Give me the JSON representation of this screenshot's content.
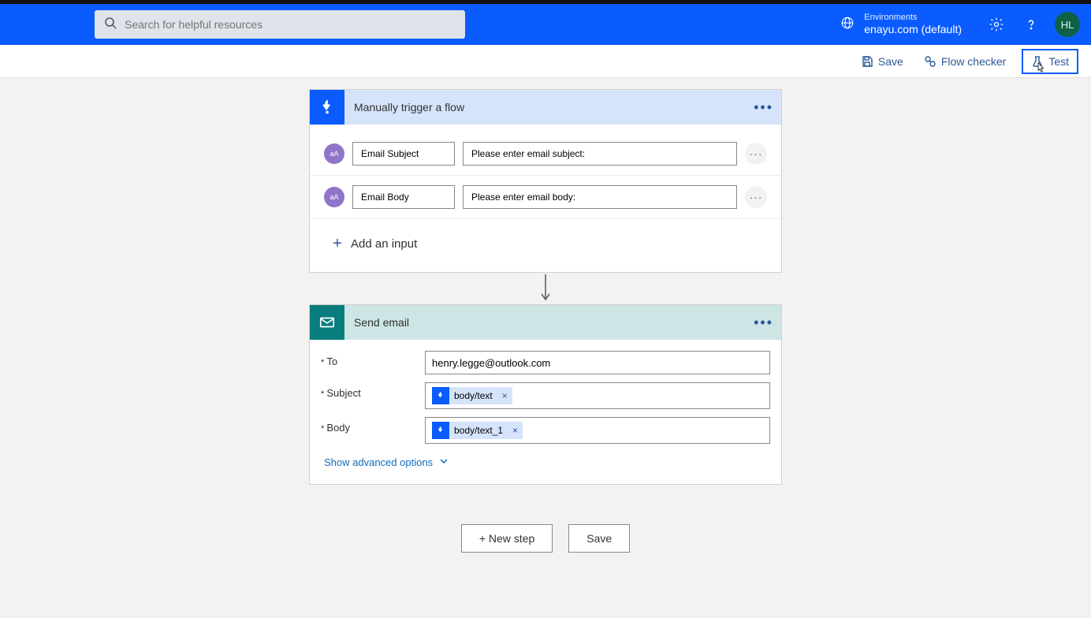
{
  "header": {
    "search_placeholder": "Search for helpful resources",
    "env_label": "Environments",
    "env_value": "enayu.com (default)",
    "avatar_initials": "HL"
  },
  "actions": {
    "save": "Save",
    "flow_checker": "Flow checker",
    "test": "Test"
  },
  "trigger": {
    "title": "Manually trigger a flow",
    "inputs": [
      {
        "name": "Email Subject",
        "prompt": "Please enter email subject:",
        "badge": "aA"
      },
      {
        "name": "Email Body",
        "prompt": "Please enter email body:",
        "badge": "aA"
      }
    ],
    "add_input_label": "Add an input"
  },
  "send_email": {
    "title": "Send email",
    "to_label": "To",
    "to_value": "henry.legge@outlook.com",
    "subject_label": "Subject",
    "subject_token": "body/text",
    "body_label": "Body",
    "body_token": "body/text_1",
    "advanced_label": "Show advanced options"
  },
  "footer": {
    "new_step": "+ New step",
    "save": "Save"
  }
}
